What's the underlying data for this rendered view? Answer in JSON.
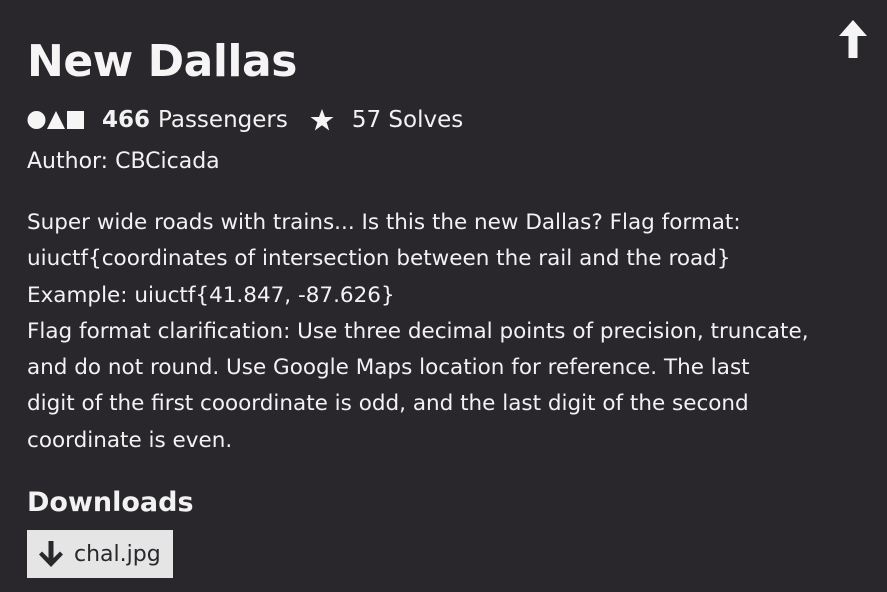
{
  "challenge": {
    "title": "New Dallas",
    "passengers_count": "466",
    "passengers_label": "Passengers",
    "solves_text": "57 Solves",
    "author_text": "Author: CBCicada"
  },
  "description_lines": [
    "Super wide roads with trains... Is this the new Dallas? Flag format:",
    "uiuctf{coordinates of intersection between the rail and the road}",
    "Example: uiuctf{41.847, -87.626}",
    "Flag format clarification: Use three decimal points of precision, truncate,",
    "and do not round. Use Google Maps location for reference. The last",
    "digit of the first cooordinate is odd, and the last digit of the second",
    "coordinate is even."
  ],
  "downloads": {
    "heading": "Downloads",
    "files": [
      {
        "name": "chal.jpg",
        "icon": "download-arrow-icon"
      }
    ]
  },
  "icons": {
    "scroll_top": "up-arrow-icon",
    "difficulty": "shapes-icon",
    "solves": "star-icon"
  },
  "colors": {
    "background": "#29272c",
    "text": "#f2f2f2",
    "button_bg": "#e5e5e5",
    "button_text": "#29272c"
  }
}
